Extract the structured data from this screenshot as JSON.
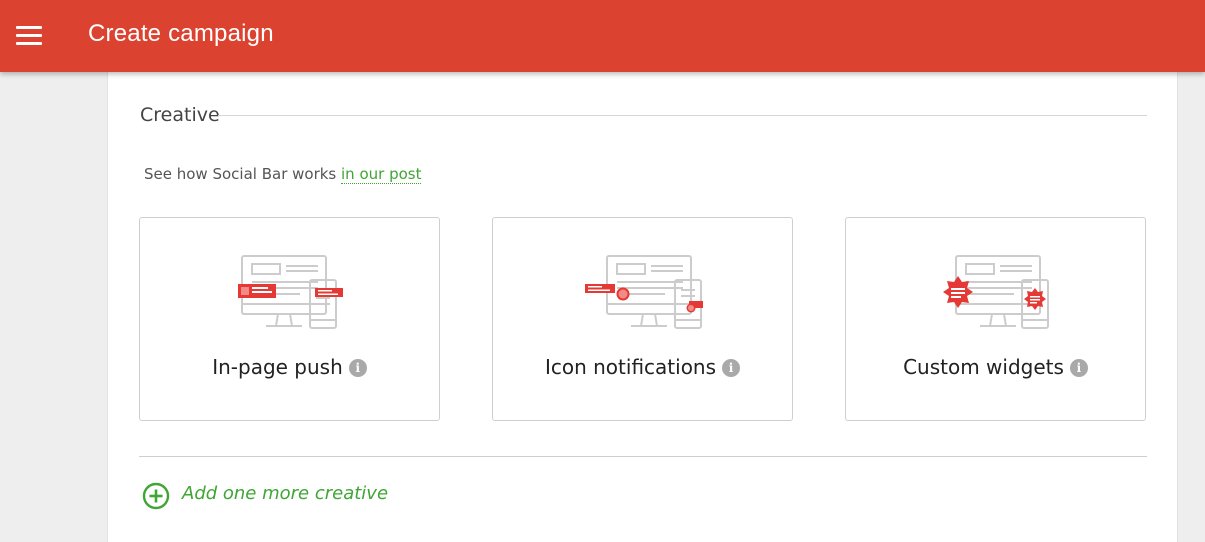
{
  "header": {
    "title": "Create campaign",
    "menu_icon": "hamburger-menu-icon",
    "background_color": "#db4330"
  },
  "creative": {
    "section_title": "Creative",
    "help_text": "See how Social Bar works ",
    "help_link": "in our post",
    "tiles": [
      {
        "label": "In-page push",
        "icon": "in-page-push-illustration"
      },
      {
        "label": "Icon notifications",
        "icon": "icon-notifications-illustration"
      },
      {
        "label": "Custom widgets",
        "icon": "custom-widgets-illustration"
      }
    ],
    "info_glyph": "i",
    "add_label": "Add one more creative",
    "accent_color": "#3fa535",
    "illustration_color": "#e53935"
  }
}
